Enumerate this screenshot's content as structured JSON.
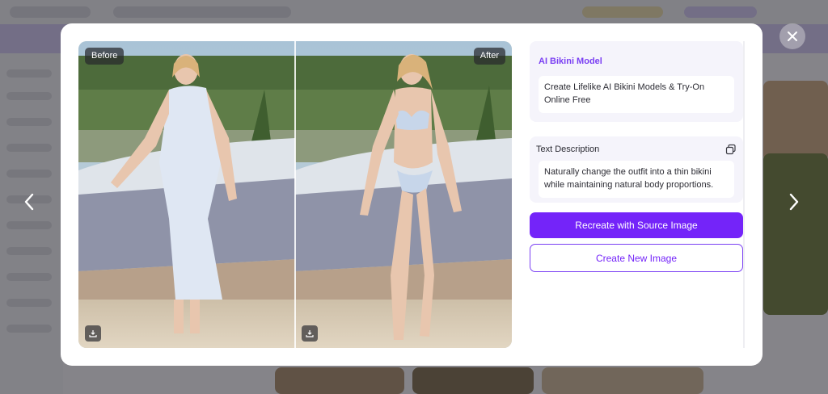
{
  "photos": {
    "before_tag": "Before",
    "after_tag": "After",
    "download_icon": "download-icon"
  },
  "panel": {
    "model_title": "AI Bikini Model",
    "model_text": "Create Lifelike AI Bikini Models & Try-On Online Free",
    "desc_title": "Text Description",
    "desc_text": "Naturally change the outfit into a thin bikini while maintaining natural body proportions.",
    "copy_icon": "copy-icon"
  },
  "buttons": {
    "recreate_label": "Recreate with Source Image",
    "create_new_label": "Create New Image"
  },
  "icons": {
    "close": "close-icon",
    "prev": "chevron-left-icon",
    "next": "chevron-right-icon"
  },
  "colors": {
    "accent": "#7424f9",
    "overlay": "#5b5a61"
  }
}
